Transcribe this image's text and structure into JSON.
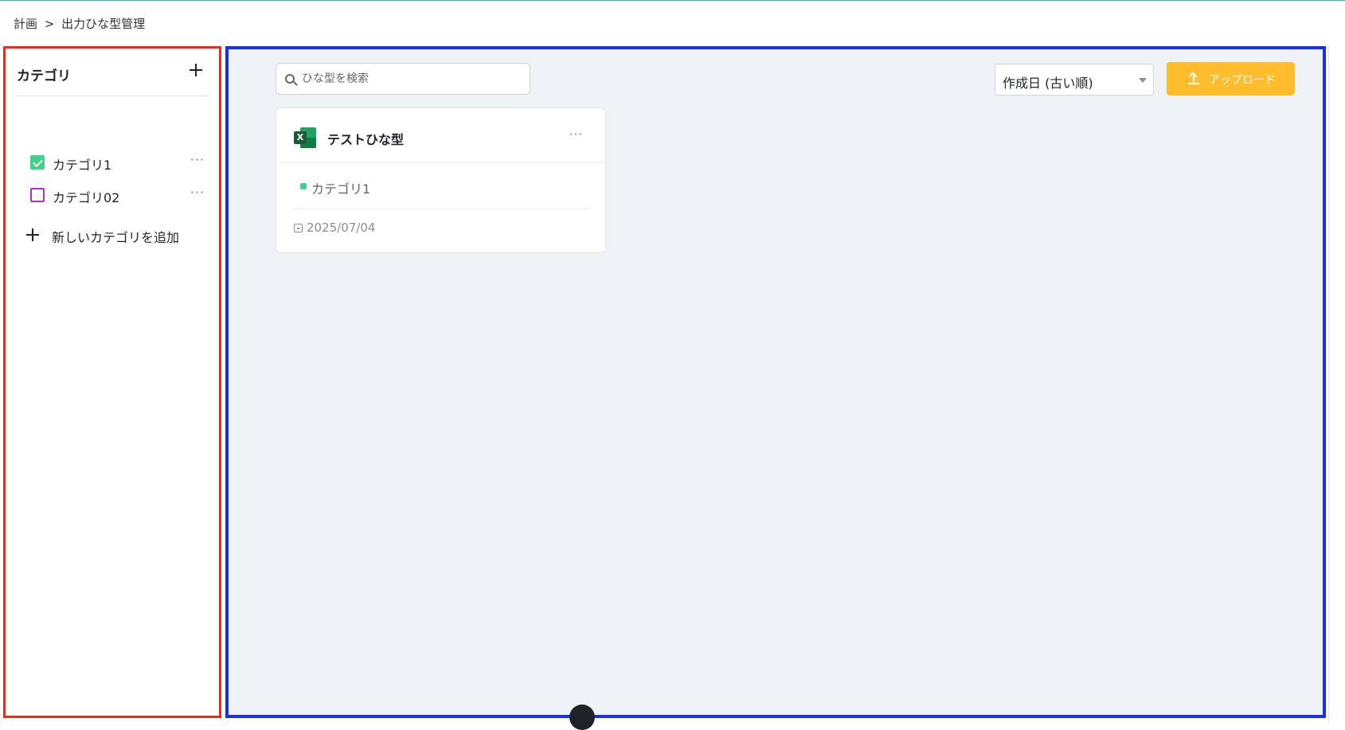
{
  "breadcrumb": {
    "parent": "計画",
    "separator": ">",
    "current": "出力ひな型管理"
  },
  "sidebar": {
    "title": "カテゴリ",
    "add_icon": "plus-icon",
    "items": [
      {
        "label": "カテゴリ1",
        "checked": true,
        "color": "#3fd38a",
        "more": "···"
      },
      {
        "label": "カテゴリ02",
        "checked": false,
        "color": "#b22ec9",
        "more": "···"
      }
    ],
    "new_category_label": "新しいカテゴリを追加"
  },
  "toolbar": {
    "search_placeholder": "ひな型を検索",
    "sort_label": "作成日 (古い順)",
    "upload_label": "アップロード",
    "upload_color": "#ffbd2e"
  },
  "cards": [
    {
      "title": "テストひな型",
      "file_icon": "excel-icon",
      "more": "···",
      "tag": "カテゴリ1",
      "tag_color": "#3fd38a",
      "date": "2025/07/04"
    }
  ],
  "highlights": {
    "sidebar_border": "#ef2b1a",
    "main_border": "#1730ee"
  }
}
